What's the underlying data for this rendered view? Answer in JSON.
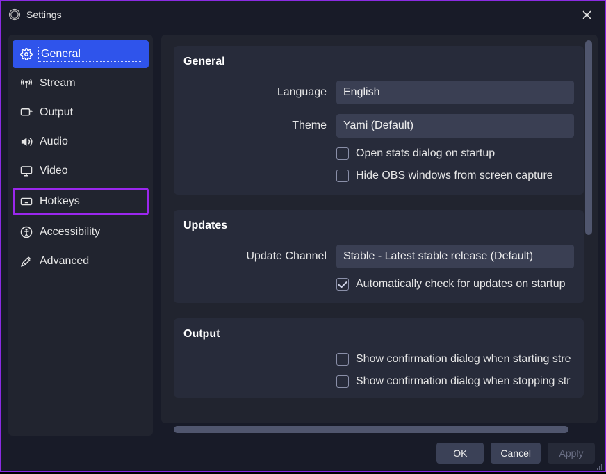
{
  "window": {
    "title": "Settings"
  },
  "sidebar": {
    "items": [
      {
        "label": "General",
        "icon": "gear-icon",
        "active": true
      },
      {
        "label": "Stream",
        "icon": "antenna-icon"
      },
      {
        "label": "Output",
        "icon": "output-icon"
      },
      {
        "label": "Audio",
        "icon": "speaker-icon"
      },
      {
        "label": "Video",
        "icon": "monitor-icon"
      },
      {
        "label": "Hotkeys",
        "icon": "keyboard-icon",
        "highlight": true
      },
      {
        "label": "Accessibility",
        "icon": "accessibility-icon"
      },
      {
        "label": "Advanced",
        "icon": "tools-icon"
      }
    ]
  },
  "sections": {
    "general": {
      "title": "General",
      "language_label": "Language",
      "language_value": "English",
      "theme_label": "Theme",
      "theme_value": "Yami (Default)",
      "check_stats": {
        "label": "Open stats dialog on startup",
        "checked": false
      },
      "check_hide": {
        "label": "Hide OBS windows from screen capture",
        "checked": false
      }
    },
    "updates": {
      "title": "Updates",
      "channel_label": "Update Channel",
      "channel_value": "Stable - Latest stable release (Default)",
      "check_auto": {
        "label": "Automatically check for updates on startup",
        "checked": true
      }
    },
    "output": {
      "title": "Output",
      "check_start": {
        "label": "Show confirmation dialog when starting stre",
        "checked": false
      },
      "check_stop": {
        "label": "Show confirmation dialog when stopping str",
        "checked": false
      }
    }
  },
  "footer": {
    "ok": "OK",
    "cancel": "Cancel",
    "apply": "Apply"
  }
}
